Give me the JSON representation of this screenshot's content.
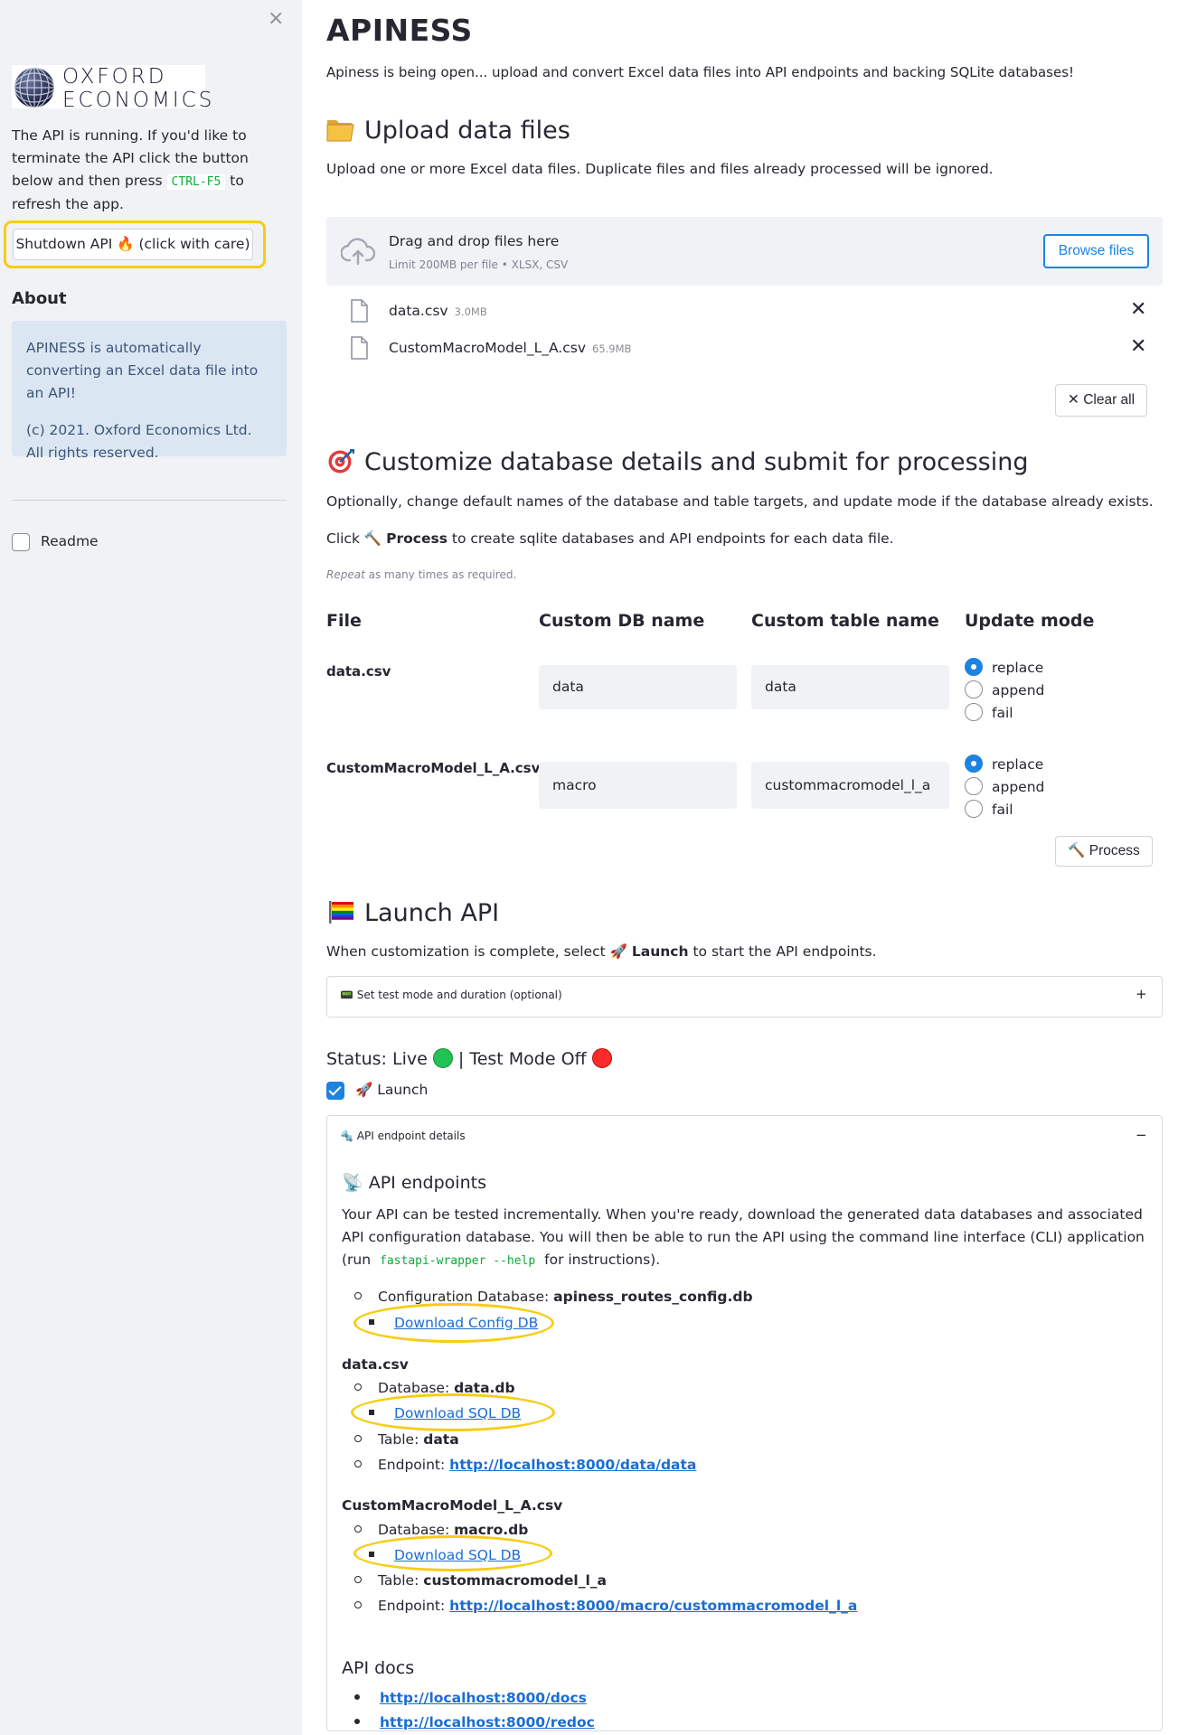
{
  "sidebar": {
    "close_symbol": "×",
    "logo_line1": "OXFORD",
    "logo_line2": "ECONOMICS",
    "intro_part1": "The API is running. If you'd like to terminate the API click the button below and then press",
    "intro_key": "CTRL-F5",
    "intro_part2": "to refresh the app.",
    "shutdown_label": "Shutdown API 🔥 (click with care)",
    "about_heading": "About",
    "about_p1": "APINESS is automatically converting an Excel data file into an API!",
    "about_p2": "(c) 2021. Oxford Economics Ltd. All rights reserved.",
    "readme_label": "Readme",
    "readme_checked": false
  },
  "main": {
    "title": "APINESS",
    "subtitle": "Apiness is being open... upload and convert Excel data files into API endpoints and backing SQLite databases!",
    "upload_heading": "Upload data files",
    "upload_desc": "Upload one or more Excel data files. Duplicate files and files already processed will be ignored.",
    "drop_main": "Drag and drop files here",
    "drop_sub": "Limit 200MB per file • XLSX, CSV",
    "browse_label": "Browse files",
    "files": [
      {
        "name": "data.csv",
        "size": "3.0MB"
      },
      {
        "name": "CustomMacroModel_L_A.csv",
        "size": "65.9MB"
      }
    ],
    "remove_symbol": "✕",
    "clear_all_label": "✕ Clear all",
    "customize_heading": "Customize database details and submit for processing",
    "customize_desc": "Optionally, change default names of the database and table targets, and update mode if the database already exists.",
    "click_prefix": "Click",
    "click_emoji": "🔨",
    "click_bold": "Process",
    "click_suffix": "to create sqlite databases and API endpoints for each data file.",
    "repeat_italic": "Repeat",
    "repeat_rest": "as many times as required.",
    "table_headers": [
      "File",
      "Custom DB name",
      "Custom table name",
      "Update mode"
    ],
    "rows": [
      {
        "file": "data.csv",
        "db": "data",
        "table": "data",
        "mode": "replace"
      },
      {
        "file": "CustomMacroModel_L_A.csv",
        "db": "macro",
        "table": "custommacromodel_l_a",
        "mode": "replace"
      }
    ],
    "mode_options": [
      "replace",
      "append",
      "fail"
    ],
    "process_label": "🔨 Process",
    "launch_heading": "Launch API",
    "launch_desc_prefix": "When customization is complete, select",
    "launch_desc_emoji": "🚀",
    "launch_desc_bold": "Launch",
    "launch_desc_suffix": "to start the API endpoints.",
    "test_mode_label": "Set test mode and duration (optional)",
    "test_mode_toggle": "+",
    "status_text_1": "Status: Live",
    "status_text_2": "| Test Mode Off",
    "live_color": "#21c354",
    "off_color": "#ff2b2b",
    "launch_checkbox_label": "🚀 Launch",
    "launch_checked": true,
    "endpoint_expander_label": "API endpoint details",
    "endpoint_toggle": "−",
    "endpoints_heading": "API endpoints",
    "endpoints_desc1": "Your API can be tested incrementally. When you're ready, download the generated data databases and associated API configuration database. You will then be able to run the API using the command line interface (CLI) application (run",
    "endpoints_cmd": "fastapi-wrapper --help",
    "endpoints_desc2": "for instructions).",
    "config_label": "Configuration Database:",
    "config_db": "apiness_routes_config.db",
    "download_config": "Download Config DB",
    "datasets": [
      {
        "file": "data.csv",
        "database_label": "Database:",
        "database": "data.db",
        "download": "Download SQL DB",
        "table_label": "Table:",
        "table": "data",
        "endpoint_label": "Endpoint:",
        "endpoint": "http://localhost:8000/data/data"
      },
      {
        "file": "CustomMacroModel_L_A.csv",
        "database_label": "Database:",
        "database": "macro.db",
        "download": "Download SQL DB",
        "table_label": "Table:",
        "table": "custommacromodel_l_a",
        "endpoint_label": "Endpoint:",
        "endpoint": "http://localhost:8000/macro/custommacromodel_l_a"
      }
    ],
    "docs_heading": "API docs",
    "docs_links": [
      "http://localhost:8000/docs",
      "http://localhost:8000/redoc"
    ]
  },
  "colors": {
    "accent": "#1c83e1",
    "highlight": "#f7cd13",
    "sidebar_bg": "#f0f2f6",
    "info_bg": "#dbe6f3"
  }
}
